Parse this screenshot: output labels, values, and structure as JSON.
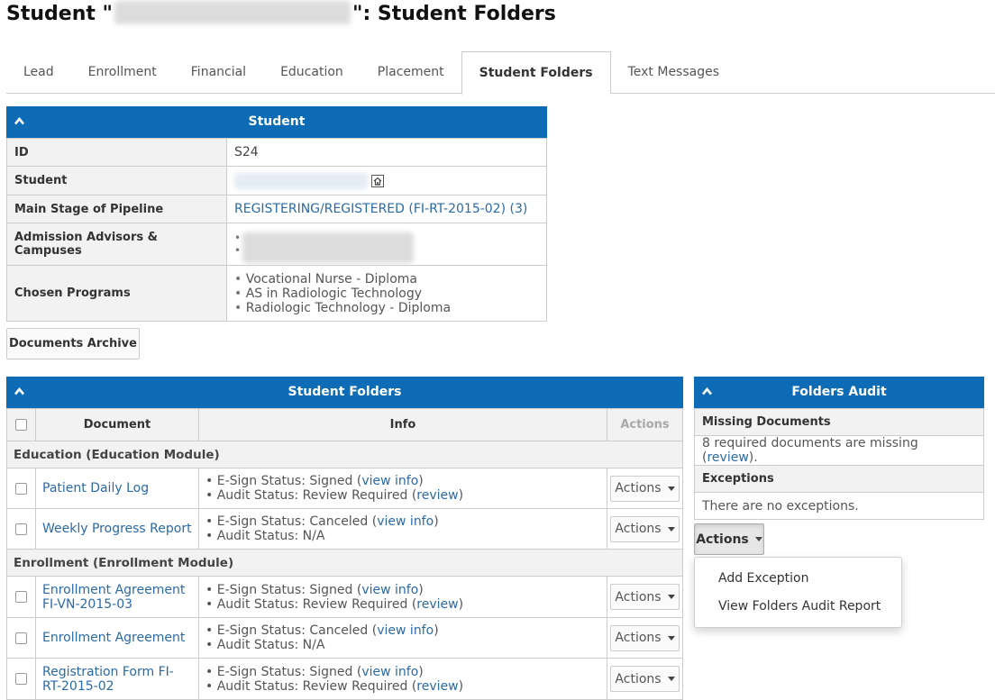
{
  "page": {
    "title_prefix": "Student \"",
    "title_suffix": "\": Student Folders"
  },
  "tabs": [
    "Lead",
    "Enrollment",
    "Financial",
    "Education",
    "Placement",
    "Student Folders",
    "Text Messages"
  ],
  "active_tab": "Student Folders",
  "student_panel": {
    "title": "Student",
    "id_label": "ID",
    "id_value": "S24",
    "student_label": "Student",
    "stage_label": "Main Stage of Pipeline",
    "stage_value": "REGISTERING/REGISTERED (FI-RT-2015-02) (3)",
    "advisors_label": "Admission Advisors & Campuses",
    "programs_label": "Chosen Programs",
    "programs": [
      "Vocational Nurse - Diploma",
      "AS in Radiologic Technology",
      "Radiologic Technology - Diploma"
    ]
  },
  "documents_archive_label": "Documents Archive",
  "folders_panel": {
    "title": "Student Folders",
    "col_document": "Document",
    "col_info": "Info",
    "col_actions": "Actions",
    "actions_label": "Actions",
    "groups": [
      {
        "name": "Education (Education Module)",
        "rows": [
          {
            "doc": "Patient Daily Log",
            "esign": "E-Sign Status: Signed (",
            "esign_link": "view info",
            "audit": "Audit Status: Review Required (",
            "audit_link": "review"
          },
          {
            "doc": "Weekly Progress Report",
            "esign": "E-Sign Status: Canceled (",
            "esign_link": "view info",
            "audit": "Audit Status: N/A",
            "audit_link": ""
          }
        ]
      },
      {
        "name": "Enrollment (Enrollment Module)",
        "rows": [
          {
            "doc": "Enrollment Agreement FI-VN-2015-03",
            "esign": "E-Sign Status: Signed (",
            "esign_link": "view info",
            "audit": "Audit Status: Review Required (",
            "audit_link": "review"
          },
          {
            "doc": "Enrollment Agreement",
            "esign": "E-Sign Status: Canceled (",
            "esign_link": "view info",
            "audit": "Audit Status: N/A",
            "audit_link": ""
          },
          {
            "doc": "Registration Form FI-RT-2015-02",
            "esign": "E-Sign Status: Signed (",
            "esign_link": "view info",
            "audit": "Audit Status: Review Required (",
            "audit_link": "review"
          }
        ]
      }
    ]
  },
  "audit_panel": {
    "title": "Folders Audit",
    "missing_label": "Missing Documents",
    "missing_text": "8 required documents are missing (",
    "missing_link": "review",
    "missing_end": ").",
    "exceptions_label": "Exceptions",
    "exceptions_text": "There are no exceptions.",
    "actions_label": "Actions",
    "menu": [
      "Add Exception",
      "View Folders Audit Report"
    ]
  },
  "colors": {
    "header_blue": "#0e6bb5",
    "link_blue": "#2a6aa8"
  },
  "icons": [
    "chevron-up-icon",
    "home-icon",
    "caret-down-icon",
    "checkbox-icon"
  ]
}
